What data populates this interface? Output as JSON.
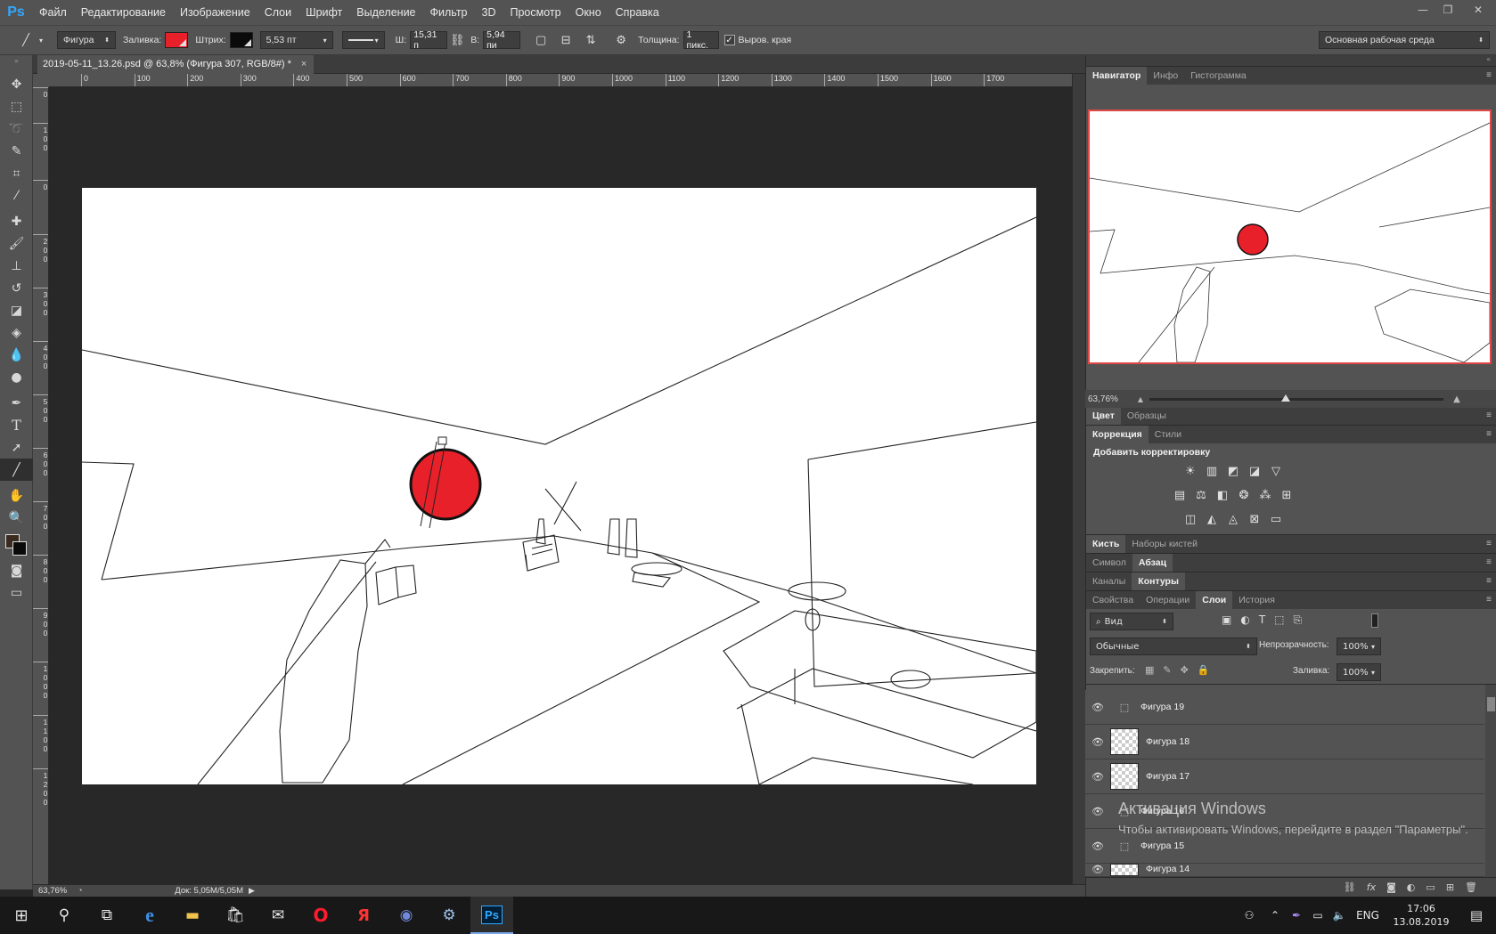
{
  "app": {
    "logo": "Ps"
  },
  "menu": [
    "Файл",
    "Редактирование",
    "Изображение",
    "Слои",
    "Шрифт",
    "Выделение",
    "Фильтр",
    "3D",
    "Просмотр",
    "Окно",
    "Справка"
  ],
  "options": {
    "mode": "Фигура",
    "fill_label": "Заливка:",
    "fill_color": "#e8202a",
    "stroke_label": "Штрих:",
    "stroke_color": "#0a0a0a",
    "stroke_width": "5,53 пт",
    "w_label": "Ш:",
    "w_value": "15,31 п",
    "h_label": "В:",
    "h_value": "5,94 пи",
    "thickness_label": "Толщина:",
    "thickness_value": "1 пикс.",
    "antialias_label": "Выров. края",
    "workspace": "Основная рабочая среда"
  },
  "document": {
    "tab_title": "2019-05-11_13.26.psd @ 63,8% (Фигура 307, RGB/8#) *",
    "close": "×"
  },
  "ruler": {
    "h_ticks": [
      "0",
      "100",
      "200",
      "300",
      "400",
      "500",
      "600",
      "700",
      "800",
      "900",
      "1000",
      "1100",
      "1200",
      "1300",
      "1400",
      "1500",
      "1600",
      "1700"
    ],
    "v_ticks": [
      "0",
      "100",
      "0",
      "200",
      "300",
      "400",
      "500",
      "600",
      "700",
      "800",
      "900",
      "1000",
      "1100",
      "1200"
    ]
  },
  "status": {
    "zoom": "63,76%",
    "doc": "Док: 5,05M/5,05M"
  },
  "panels": {
    "nav_tabs": [
      "Навигатор",
      "Инфо",
      "Гистограмма"
    ],
    "nav_zoom": "63,76%",
    "color_tabs": [
      "Цвет",
      "Образцы"
    ],
    "adjust_tabs": [
      "Коррекция",
      "Стили"
    ],
    "adjust_title": "Добавить корректировку",
    "brush_tabs": [
      "Кисть",
      "Наборы кистей"
    ],
    "char_tabs": [
      "Символ",
      "Абзац"
    ],
    "channels_tabs": [
      "Каналы",
      "Контуры"
    ],
    "layers_tabs": [
      "Свойства",
      "Операции",
      "Слои",
      "История"
    ],
    "layer_filter": "Вид",
    "blend_mode": "Обычные",
    "opacity_label": "Непрозрачность:",
    "opacity_value": "100%",
    "lock_label": "Закрепить:",
    "fill_label": "Заливка:",
    "fill_value": "100%"
  },
  "layers": [
    {
      "name": "Фигура 19"
    },
    {
      "name": "Фигура 18"
    },
    {
      "name": "Фигура 17"
    },
    {
      "name": "Фигура 16"
    },
    {
      "name": "Фигура 15"
    },
    {
      "name": "Фигура 14"
    }
  ],
  "watermark": {
    "title": "Активация Windows",
    "text": "Чтобы активировать Windows, перейдите в раздел \"Параметры\"."
  },
  "taskbar": {
    "lang": "ENG",
    "time": "17:06",
    "date": "13.08.2019"
  }
}
